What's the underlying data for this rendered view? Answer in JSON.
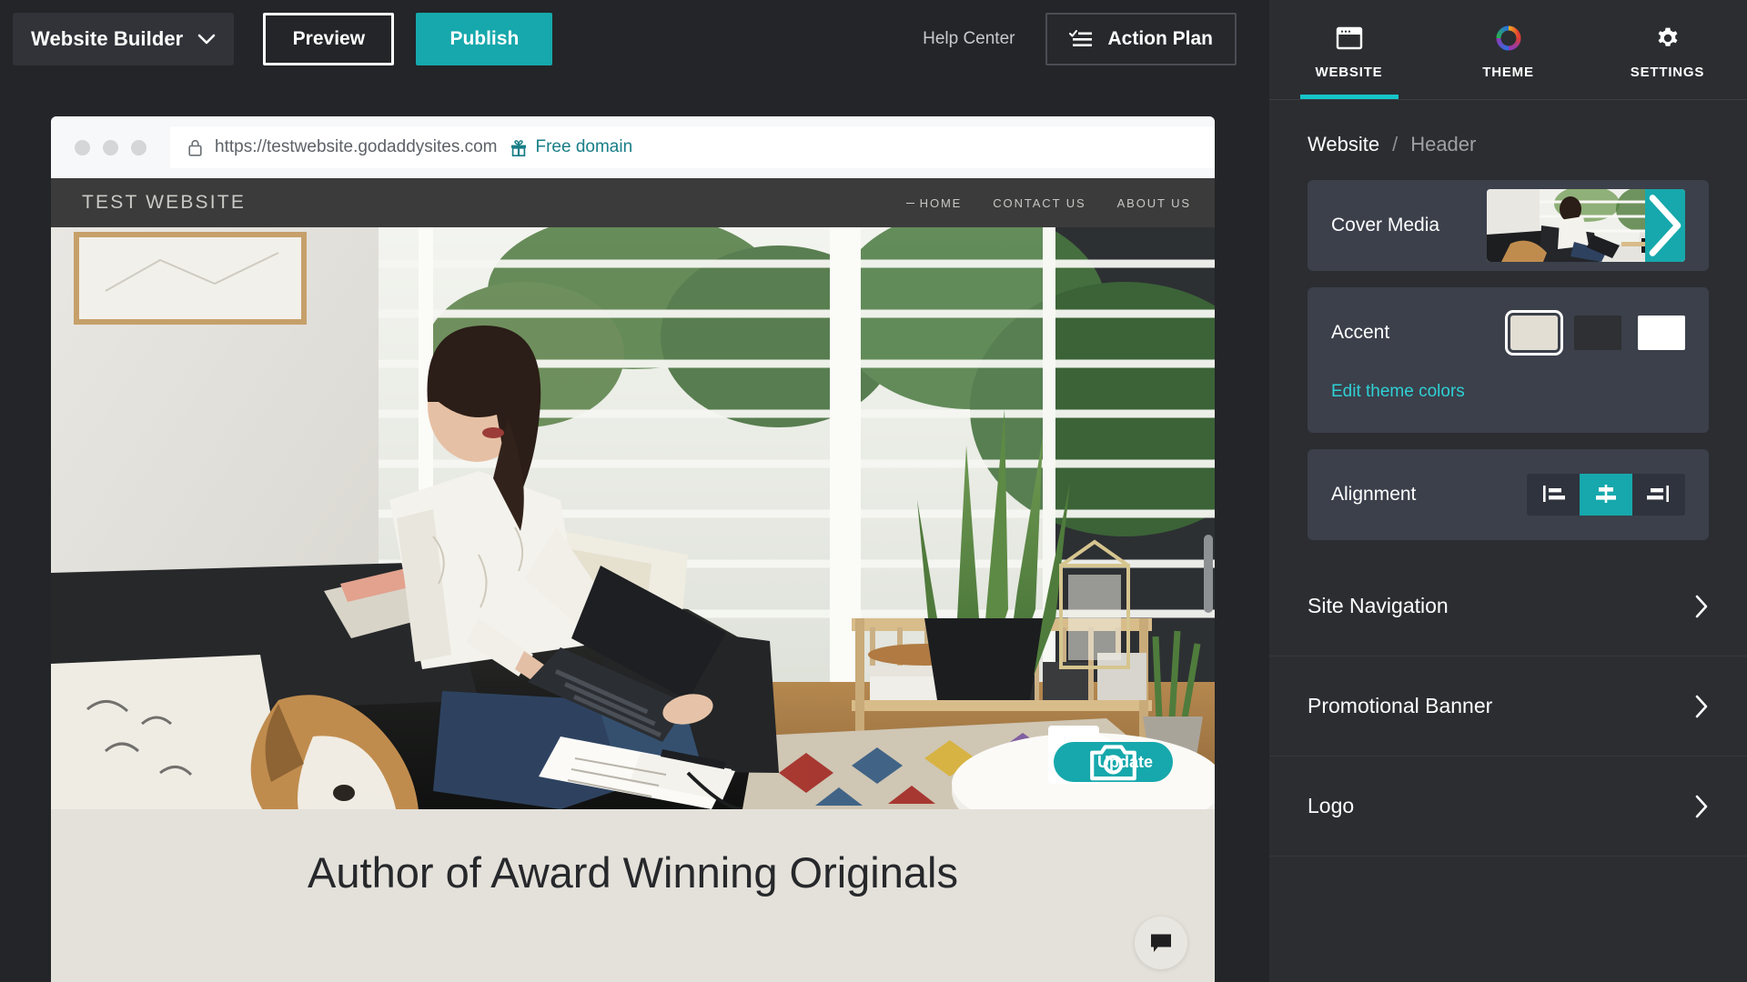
{
  "toolbar": {
    "builder_menu_label": "Website Builder",
    "builder_menu_icon": "chevron-down-icon",
    "preview_label": "Preview",
    "publish_label": "Publish",
    "help_center_label": "Help Center",
    "action_plan_label": "Action Plan",
    "action_plan_icon": "checklist-icon",
    "publish_color": "#16A8AC"
  },
  "preview": {
    "browser": {
      "lock_icon": "lock-icon",
      "url": "https://testwebsite.godaddysites.com",
      "gift_icon": "gift-icon",
      "free_domain_label": "Free domain",
      "free_domain_color": "#187e87"
    },
    "site": {
      "logo_text": "TEST WEBSITE",
      "nav": [
        {
          "label": "HOME",
          "active": true
        },
        {
          "label": "CONTACT US",
          "active": false
        },
        {
          "label": "ABOUT US",
          "active": false
        }
      ],
      "heading": "Author of Award Winning Originals",
      "heading_bg": "#e4e1da",
      "header_bg": "#3b3b3b"
    },
    "update_button": {
      "label": "Update",
      "icon": "camera-icon",
      "color": "#16A8AC"
    },
    "chat_icon": "chat-bubble-icon"
  },
  "sidebar": {
    "tabs": [
      {
        "label": "WEBSITE",
        "icon": "browser-window-icon",
        "active": true
      },
      {
        "label": "THEME",
        "icon": "color-wheel-icon",
        "active": false
      },
      {
        "label": "SETTINGS",
        "icon": "gear-icon",
        "active": false
      }
    ],
    "active_tab_indicator_color": "#16C4C9",
    "breadcrumb": {
      "root": "Website",
      "separator": "/",
      "current": "Header"
    },
    "cover_media": {
      "label": "Cover Media",
      "chevron_icon": "chevron-right-icon",
      "chevron_bg": "#16A8AC"
    },
    "accent": {
      "label": "Accent",
      "swatches": [
        {
          "name": "beige",
          "color": "#e3ded4",
          "selected": true
        },
        {
          "name": "dark",
          "color": "#2e3033",
          "selected": false
        },
        {
          "name": "white",
          "color": "#ffffff",
          "selected": false
        }
      ],
      "edit_link_label": "Edit theme colors",
      "edit_link_color": "#2fd0d4"
    },
    "alignment": {
      "label": "Alignment",
      "options": [
        {
          "name": "align-left",
          "selected": false
        },
        {
          "name": "align-center",
          "selected": true
        },
        {
          "name": "align-right",
          "selected": false
        }
      ],
      "selected_color": "#16A8AC"
    },
    "sections": [
      {
        "label": "Site Navigation",
        "icon": "chevron-right-icon"
      },
      {
        "label": "Promotional Banner",
        "icon": "chevron-right-icon"
      },
      {
        "label": "Logo",
        "icon": "chevron-right-icon"
      }
    ]
  }
}
